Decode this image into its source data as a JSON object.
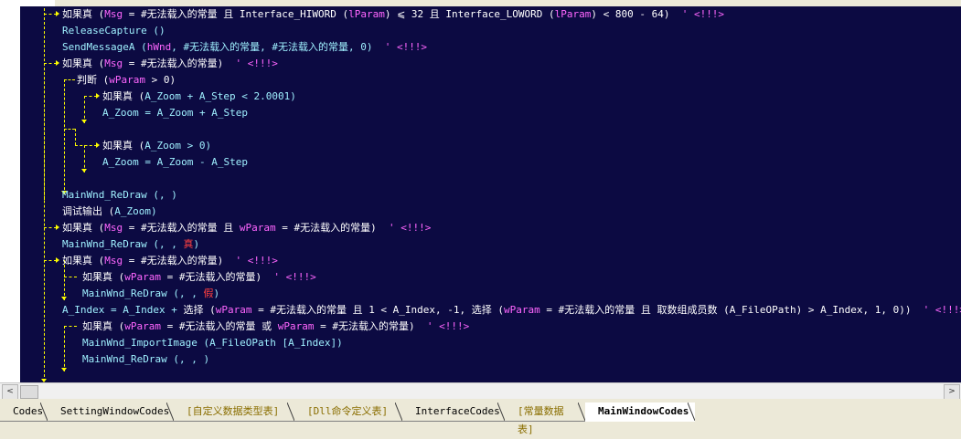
{
  "code_lines": [
    {
      "indent": 0,
      "tokens": [
        {
          "c": "kw",
          "t": "如果真 ("
        },
        {
          "c": "var",
          "t": "Msg"
        },
        {
          "c": "op",
          "t": " = #无法载入的常量 且 Interface_HIWORD ("
        },
        {
          "c": "var",
          "t": "lParam"
        },
        {
          "c": "op",
          "t": ") ⩽ 32 且 Interface_LOWORD ("
        },
        {
          "c": "var",
          "t": "lParam"
        },
        {
          "c": "op",
          "t": ") < 800 - 64)"
        },
        {
          "c": "cmt",
          "t": "  ' <!!!>"
        }
      ]
    },
    {
      "indent": 1,
      "tokens": [
        {
          "c": "cmd",
          "t": "ReleaseCapture ()"
        }
      ]
    },
    {
      "indent": 1,
      "tokens": [
        {
          "c": "cmd",
          "t": "SendMessageA ("
        },
        {
          "c": "var",
          "t": "hWnd"
        },
        {
          "c": "cmd",
          "t": ", #无法载入的常量, #无法载入的常量, 0)"
        },
        {
          "c": "cmt",
          "t": "  ' <!!!>"
        }
      ]
    },
    {
      "indent": 0,
      "tokens": [
        {
          "c": "kw",
          "t": "如果真 ("
        },
        {
          "c": "var",
          "t": "Msg"
        },
        {
          "c": "op",
          "t": " = #无法载入的常量)"
        },
        {
          "c": "cmt",
          "t": "  ' <!!!>"
        }
      ]
    },
    {
      "indent": 1,
      "tokens": [
        {
          "c": "kw",
          "t": "判断 ("
        },
        {
          "c": "var",
          "t": "wParam"
        },
        {
          "c": "op",
          "t": " > 0)"
        }
      ]
    },
    {
      "indent": 2,
      "tokens": [
        {
          "c": "kw",
          "t": "如果真 ("
        },
        {
          "c": "cmd",
          "t": "A_Zoom + A_Step < 2.0001)"
        }
      ]
    },
    {
      "indent": 3,
      "tokens": [
        {
          "c": "cmd",
          "t": "A_Zoom = A_Zoom + A_Step"
        }
      ]
    },
    {
      "indent": 0,
      "tokens": []
    },
    {
      "indent": 2,
      "tokens": [
        {
          "c": "kw",
          "t": "如果真 ("
        },
        {
          "c": "cmd",
          "t": "A_Zoom > 0)"
        }
      ]
    },
    {
      "indent": 3,
      "tokens": [
        {
          "c": "cmd",
          "t": "A_Zoom = A_Zoom - A_Step"
        }
      ]
    },
    {
      "indent": 0,
      "tokens": []
    },
    {
      "indent": 1,
      "tokens": [
        {
          "c": "cmd",
          "t": "MainWnd_ReDraw (, )"
        }
      ]
    },
    {
      "indent": 1,
      "tokens": [
        {
          "c": "kw",
          "t": "调试输出 ("
        },
        {
          "c": "cmd",
          "t": "A_Zoom)"
        }
      ]
    },
    {
      "indent": 0,
      "tokens": [
        {
          "c": "kw",
          "t": "如果真 ("
        },
        {
          "c": "var",
          "t": "Msg"
        },
        {
          "c": "op",
          "t": " = #无法载入的常量 且 "
        },
        {
          "c": "var",
          "t": "wParam"
        },
        {
          "c": "op",
          "t": " = #无法载入的常量)"
        },
        {
          "c": "cmt",
          "t": "  ' <!!!>"
        }
      ]
    },
    {
      "indent": 1,
      "tokens": [
        {
          "c": "cmd",
          "t": "MainWnd_ReDraw (, , "
        },
        {
          "c": "red",
          "t": "真"
        },
        {
          "c": "cmd",
          "t": ")"
        }
      ]
    },
    {
      "indent": 0,
      "tokens": [
        {
          "c": "kw",
          "t": "如果真 ("
        },
        {
          "c": "var",
          "t": "Msg"
        },
        {
          "c": "op",
          "t": " = #无法载入的常量)"
        },
        {
          "c": "cmt",
          "t": "  ' <!!!>"
        }
      ]
    },
    {
      "indent": 2,
      "tokens": [
        {
          "c": "kw",
          "t": "如果真 ("
        },
        {
          "c": "var",
          "t": "wParam"
        },
        {
          "c": "op",
          "t": " = #无法载入的常量)"
        },
        {
          "c": "cmt",
          "t": "  ' <!!!>"
        }
      ]
    },
    {
      "indent": 3,
      "tokens": [
        {
          "c": "cmd",
          "t": "MainWnd_ReDraw (, , "
        },
        {
          "c": "red",
          "t": "假"
        },
        {
          "c": "cmd",
          "t": ")"
        }
      ]
    },
    {
      "indent": 1,
      "tokens": [
        {
          "c": "cmd",
          "t": "A_Index = A_Index + "
        },
        {
          "c": "kw",
          "t": "选择 ("
        },
        {
          "c": "var",
          "t": "wParam"
        },
        {
          "c": "op",
          "t": " = #无法载入的常量 且 1 < A_Index, -1, 选择 ("
        },
        {
          "c": "var",
          "t": "wParam"
        },
        {
          "c": "op",
          "t": " = #无法载入的常量 且 取数组成员数 (A_FileOPath) > A_Index, 1, 0))"
        },
        {
          "c": "cmt",
          "t": "  ' <!!!>"
        }
      ]
    },
    {
      "indent": 2,
      "tokens": [
        {
          "c": "kw",
          "t": "如果真 ("
        },
        {
          "c": "var",
          "t": "wParam"
        },
        {
          "c": "op",
          "t": " = #无法载入的常量 或 "
        },
        {
          "c": "var",
          "t": "wParam"
        },
        {
          "c": "op",
          "t": " = #无法载入的常量)"
        },
        {
          "c": "cmt",
          "t": "  ' <!!!>"
        }
      ]
    },
    {
      "indent": 3,
      "tokens": [
        {
          "c": "cmd",
          "t": "MainWnd_ImportImage (A_FileOPath [A_Index])"
        }
      ]
    },
    {
      "indent": 3,
      "tokens": [
        {
          "c": "cmd",
          "t": "MainWnd_ReDraw (, , )"
        }
      ]
    }
  ],
  "tabs": [
    {
      "label": "Codes",
      "style": "normal"
    },
    {
      "label": "SettingWindowCodes",
      "style": "normal"
    },
    {
      "label": "[自定义数据类型表]",
      "style": "bracket"
    },
    {
      "label": "[Dll命令定义表]",
      "style": "bracket"
    },
    {
      "label": "InterfaceCodes",
      "style": "normal"
    },
    {
      "label": "[常量数据表]",
      "style": "bracket"
    },
    {
      "label": "MainWindowCodes",
      "style": "active"
    }
  ],
  "gutter_markers": {
    "breakpoint": "▸▸",
    "fold": "+"
  },
  "scroll_buttons": {
    "left": "<",
    "right": ">"
  },
  "colors": {
    "editor_bg": "#0c0a42",
    "guide": "#ffff00",
    "comment": "#ff66ff",
    "text": "#ffffff",
    "command": "#9ff0ff"
  }
}
